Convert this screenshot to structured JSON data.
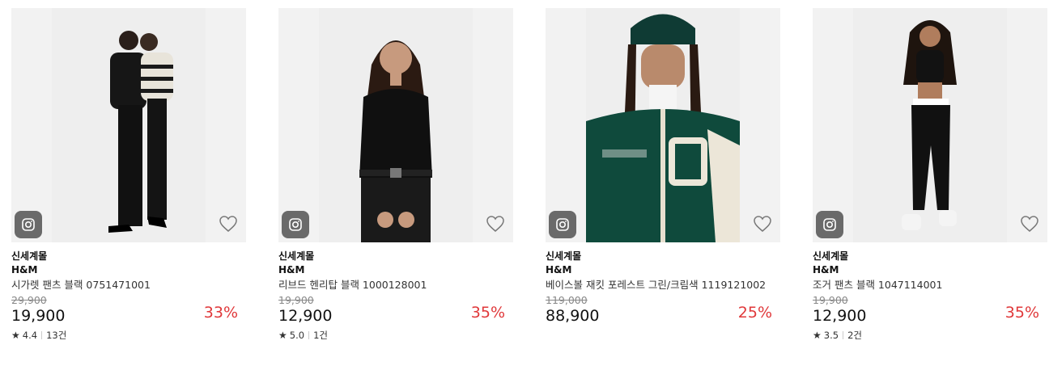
{
  "products": [
    {
      "store": "신세계몰",
      "brand": "H&M",
      "name": "시가렛 팬츠 블랙 0751471001",
      "original_price": "29,900",
      "price": "19,900",
      "discount": "33%",
      "rating": "4.4",
      "reviews": "13건"
    },
    {
      "store": "신세계몰",
      "brand": "H&M",
      "name": "리브드 헨리탑 블랙 1000128001",
      "original_price": "19,900",
      "price": "12,900",
      "discount": "35%",
      "rating": "5.0",
      "reviews": "1건"
    },
    {
      "store": "신세계몰",
      "brand": "H&M",
      "name": "베이스볼 재킷 포레스트 그린/크림색 1119121002",
      "original_price": "119,000",
      "price": "88,900",
      "discount": "25%"
    },
    {
      "store": "신세계몰",
      "brand": "H&M",
      "name": "조거 팬츠 블랙 1047114001",
      "original_price": "19,900",
      "price": "12,900",
      "discount": "35%",
      "rating": "3.5",
      "reviews": "2건"
    }
  ],
  "icons": {
    "share": "instagram-icon",
    "wishlist": "heart-outline-icon",
    "rating": "star-icon"
  },
  "colors": {
    "discount": "#e0383a",
    "insta_bg": "#6a6a6a"
  }
}
